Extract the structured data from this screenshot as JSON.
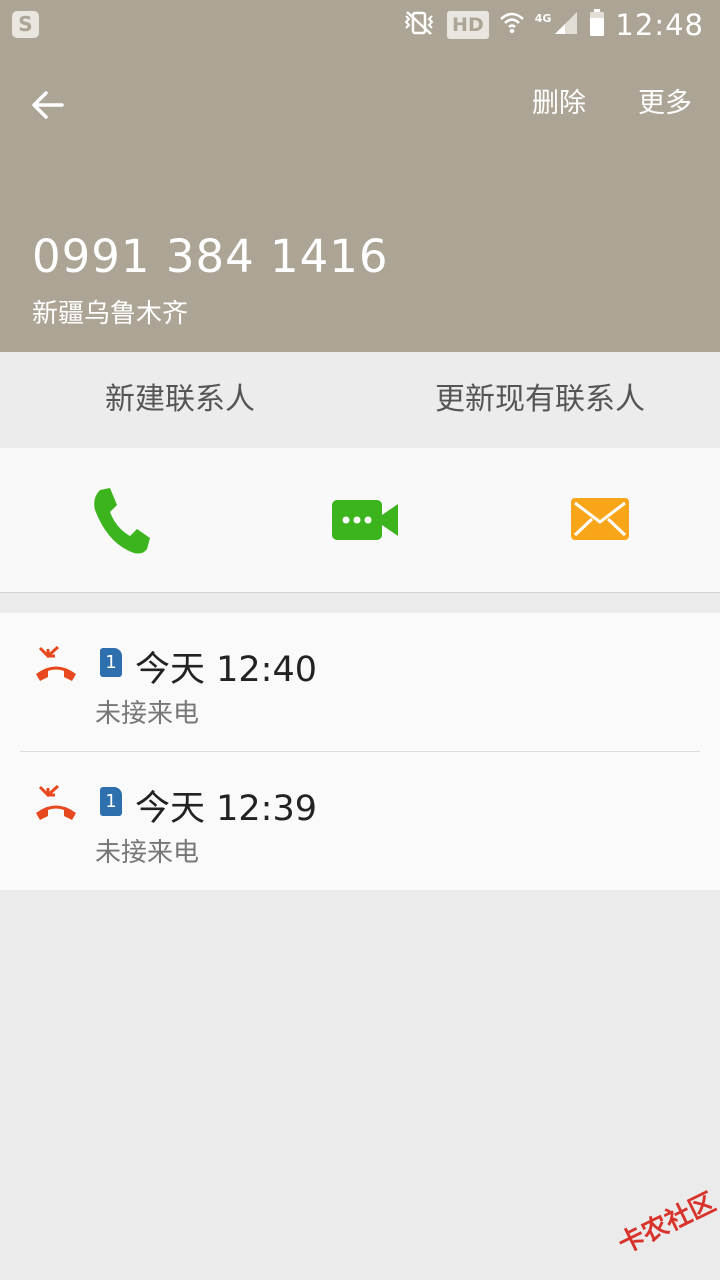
{
  "status_bar": {
    "app_icon": "S",
    "hd_label": "HD",
    "network_label": "4G",
    "time": "12:48"
  },
  "header": {
    "delete_label": "删除",
    "more_label": "更多",
    "phone_number": "0991 384 1416",
    "location": "新疆乌鲁木齐"
  },
  "contact_actions": {
    "new_contact": "新建联系人",
    "update_contact": "更新现有联系人"
  },
  "communication": {
    "call_icon": "phone-icon",
    "video_icon": "video-call-icon",
    "message_icon": "message-icon",
    "colors": {
      "call": "#3cb41e",
      "video": "#3cb41e",
      "message": "#f9a51a"
    }
  },
  "call_log": [
    {
      "sim": "1",
      "time": "今天 12:40",
      "status": "未接来电"
    },
    {
      "sim": "1",
      "time": "今天 12:39",
      "status": "未接来电"
    }
  ],
  "watermark": {
    "text": "卡农社区"
  },
  "colors": {
    "header_bg": "#aca596",
    "missed_call": "#e8481e",
    "sim_badge": "#2e6fae"
  }
}
